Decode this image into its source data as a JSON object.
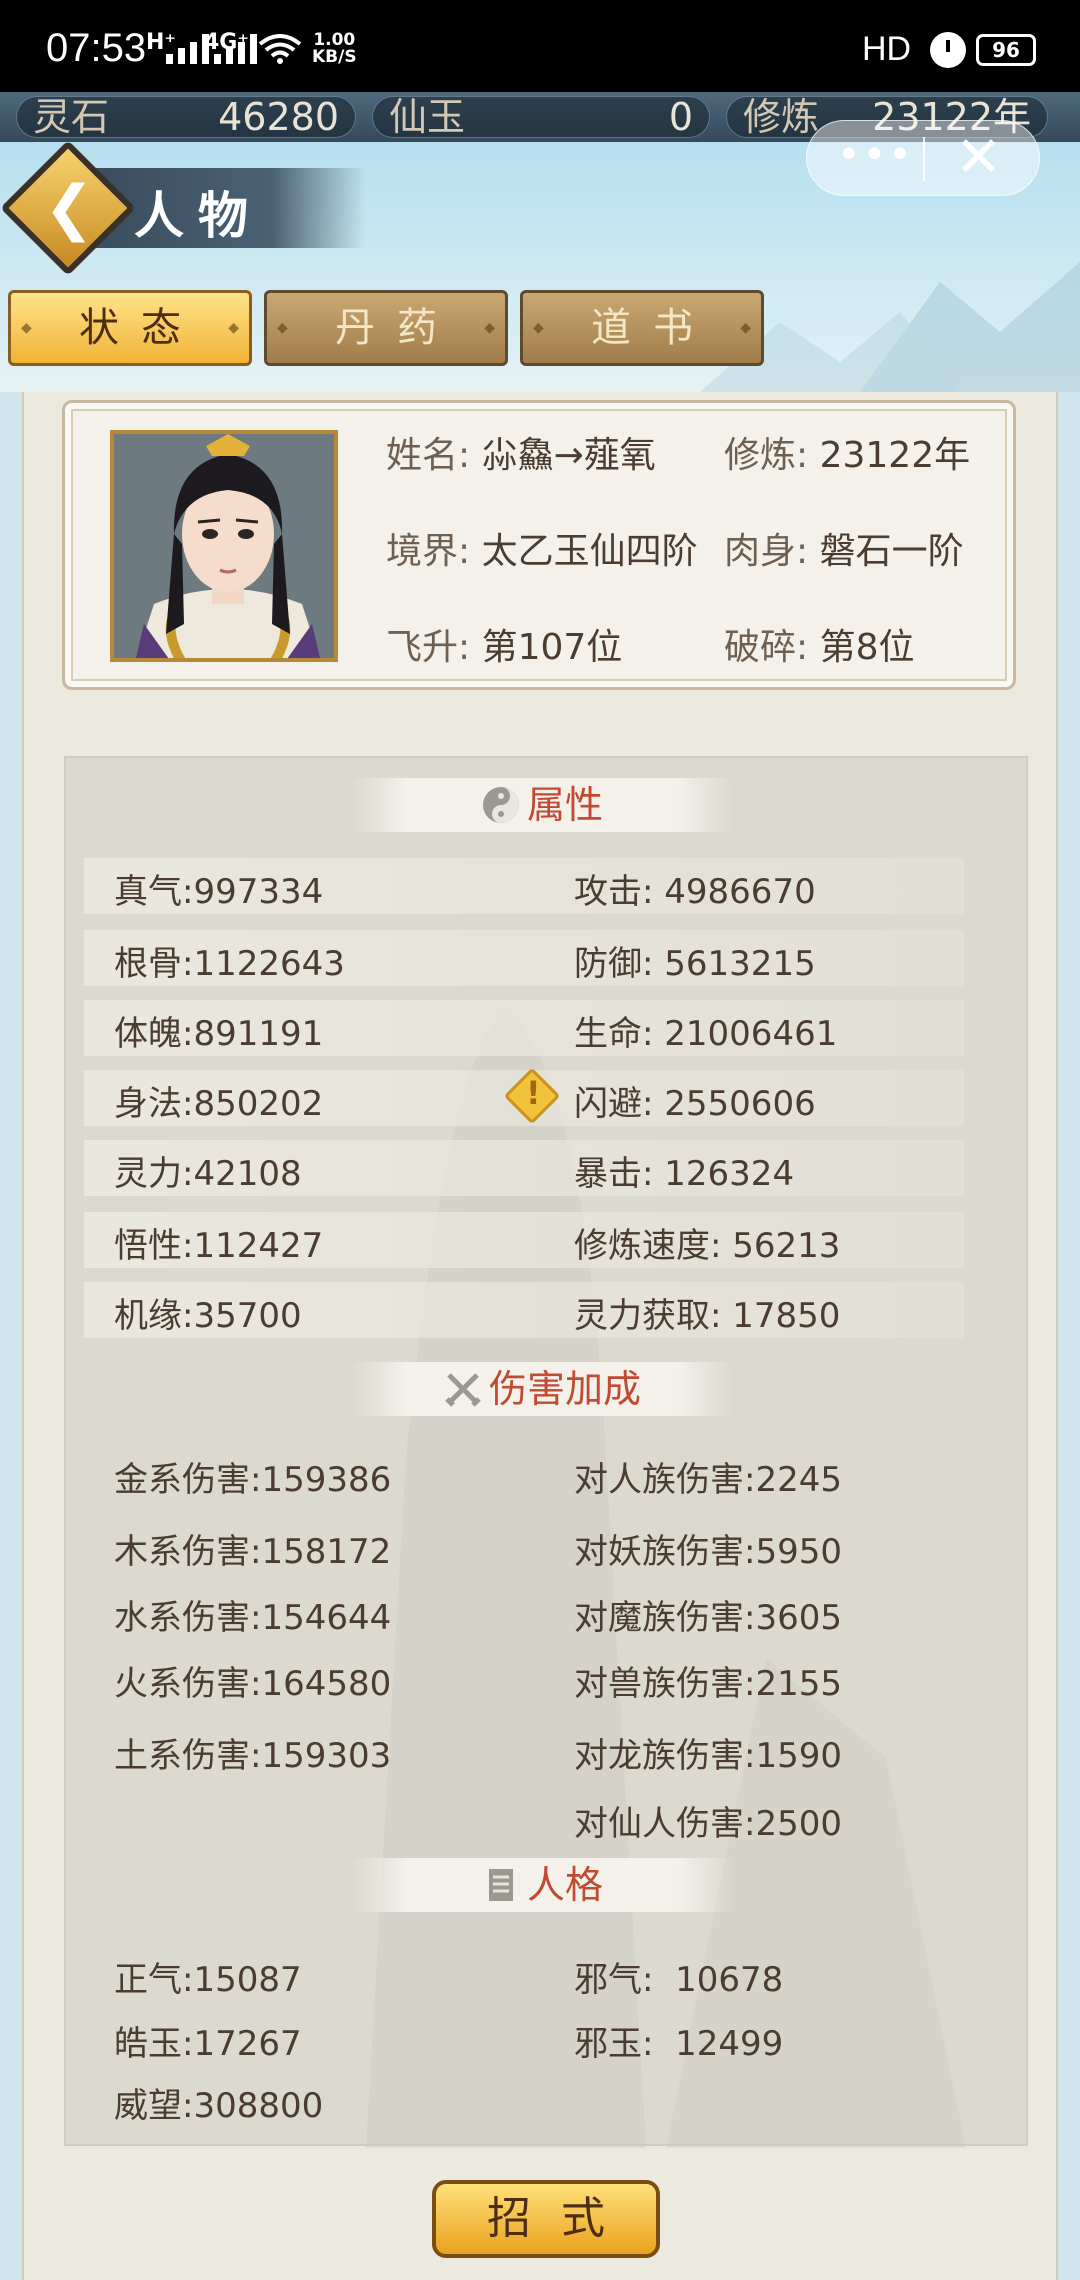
{
  "status_bar": {
    "time": "07:53",
    "net1": "H⁺",
    "net2": "4G⁺",
    "speed_value": "1.00",
    "speed_unit": "KB/S",
    "hd": "HD",
    "battery": "96"
  },
  "resources": [
    {
      "label": "灵石",
      "value": "46280"
    },
    {
      "label": "仙玉",
      "value": "0"
    },
    {
      "label": "修炼",
      "value": "23122年"
    }
  ],
  "header": {
    "title": "人物",
    "more_icon": "more-dots-icon",
    "close_icon": "close-icon"
  },
  "tabs": [
    {
      "label": "状态",
      "active": true
    },
    {
      "label": "丹药",
      "active": false
    },
    {
      "label": "道书",
      "active": false
    }
  ],
  "profile": {
    "name_label": "姓名:",
    "name": "尛鱻→薤氧",
    "cultivation_label": "修炼:",
    "cultivation": "23122年",
    "realm_label": "境界:",
    "realm": "太乙玉仙四阶",
    "body_label": "肉身:",
    "body": "磐石一阶",
    "ascend_label": "飞升:",
    "ascend": "第107位",
    "shatter_label": "破碎:",
    "shatter": "第8位"
  },
  "sections": {
    "attributes_title": "属性",
    "damage_title": "伤害加成",
    "personality_title": "人格"
  },
  "attributes_left": [
    {
      "label": "真气:",
      "value": "997334"
    },
    {
      "label": "根骨:",
      "value": "1122643"
    },
    {
      "label": "体魄:",
      "value": "891191"
    },
    {
      "label": "身法:",
      "value": "850202"
    },
    {
      "label": "灵力:",
      "value": "42108"
    },
    {
      "label": "悟性:",
      "value": "112427"
    },
    {
      "label": "机缘:",
      "value": "35700"
    }
  ],
  "attributes_right": [
    {
      "label": "攻击:",
      "value": "4986670"
    },
    {
      "label": "防御:",
      "value": "5613215"
    },
    {
      "label": "生命:",
      "value": "21006461"
    },
    {
      "label": "闪避:",
      "value": "2550606"
    },
    {
      "label": "暴击:",
      "value": "126324"
    },
    {
      "label": "修炼速度:",
      "value": "56213"
    },
    {
      "label": "灵力获取:",
      "value": "17850"
    }
  ],
  "damage_left": [
    {
      "label": "金系伤害:",
      "value": "159386"
    },
    {
      "label": "木系伤害:",
      "value": "158172"
    },
    {
      "label": "水系伤害:",
      "value": "154644"
    },
    {
      "label": "火系伤害:",
      "value": "164580"
    },
    {
      "label": "土系伤害:",
      "value": "159303"
    }
  ],
  "damage_right": [
    {
      "label": "对人族伤害:",
      "value": "2245"
    },
    {
      "label": "对妖族伤害:",
      "value": "5950"
    },
    {
      "label": "对魔族伤害:",
      "value": "3605"
    },
    {
      "label": "对兽族伤害:",
      "value": "2155"
    },
    {
      "label": "对龙族伤害:",
      "value": "1590"
    },
    {
      "label": "对仙人伤害:",
      "value": "2500"
    }
  ],
  "personality_left": [
    {
      "label": "正气:",
      "value": "15087"
    },
    {
      "label": "皓玉:",
      "value": "17267"
    },
    {
      "label": "威望:",
      "value": "308800"
    }
  ],
  "personality_right": [
    {
      "label": "邪气:",
      "value": "10678"
    },
    {
      "label": "邪玉:",
      "value": "12499"
    }
  ],
  "skill_button": "招式",
  "colors": {
    "accent_gold": "#f1b336",
    "section_red": "#c04a32",
    "panel_bg": "#ece9df"
  }
}
